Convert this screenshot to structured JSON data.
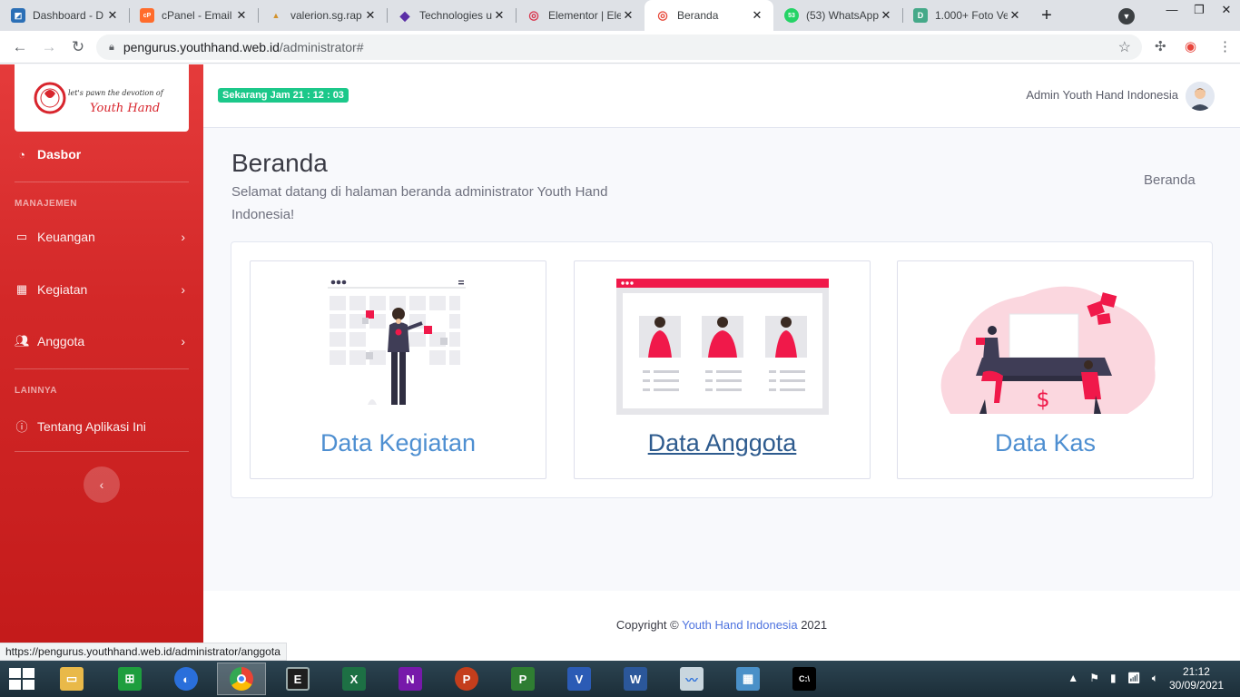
{
  "browser": {
    "tabs": [
      {
        "label": "Dashboard - D",
        "fav_color": "#2b6fb6",
        "fav_glyph": "◩"
      },
      {
        "label": "cPanel - Email",
        "fav_color": "#ff6c2c",
        "fav_glyph": "cP"
      },
      {
        "label": "valerion.sg.rap",
        "fav_color": "#d2922c",
        "fav_glyph": "▲"
      },
      {
        "label": "Technologies u",
        "fav_color": "#5a2ea6",
        "fav_glyph": "◆"
      },
      {
        "label": "Elementor | Ele",
        "fav_color": "#d9344c",
        "fav_glyph": "◎"
      },
      {
        "label": "Beranda",
        "fav_color": "#e74a3b",
        "fav_glyph": "◎"
      },
      {
        "label": "(53) WhatsApp",
        "fav_color": "#25d366",
        "fav_glyph": "53"
      },
      {
        "label": "1.000+ Foto Ve",
        "fav_color": "#45a989",
        "fav_glyph": "D"
      }
    ],
    "active_tab": 5,
    "url_host": "pengurus.youthhand.web.id",
    "url_path": "/administrator#",
    "status_url": "https://pengurus.youthhand.web.id/administrator/anggota"
  },
  "sidebar": {
    "dashboard_label": "Dasbor",
    "section_manage": "MANAJEMEN",
    "items": [
      {
        "label": "Keuangan",
        "icon": "money-icon"
      },
      {
        "label": "Kegiatan",
        "icon": "calendar-icon"
      },
      {
        "label": "Anggota",
        "icon": "users-icon"
      }
    ],
    "section_other": "LAINNYA",
    "about_label": "Tentang Aplikasi Ini",
    "logo_text_line1": "let's pawn the devotion of",
    "logo_text_line2": "Youth Hand"
  },
  "topbar": {
    "clock_prefix": "Sekarang Jam",
    "clock_time": "21 : 12 : 03",
    "user_name": "Admin Youth Hand Indonesia"
  },
  "main": {
    "title": "Beranda",
    "subtitle": "Selamat datang di halaman beranda administrator Youth Hand Indonesia!",
    "breadcrumb": "Beranda",
    "cards": [
      {
        "label": "Data Kegiatan"
      },
      {
        "label": "Data Anggota"
      },
      {
        "label": "Data Kas"
      }
    ]
  },
  "footer": {
    "prefix": "Copyright ©",
    "brand": "Youth Hand Indonesia",
    "year": "2021"
  },
  "taskbar": {
    "time": "21:12",
    "date": "30/09/2021"
  },
  "colors": {
    "accent_red": "#e74a3b",
    "link_blue": "#4e8fd1",
    "success_green": "#1cc88a",
    "illustration_pink": "#f0194a"
  }
}
